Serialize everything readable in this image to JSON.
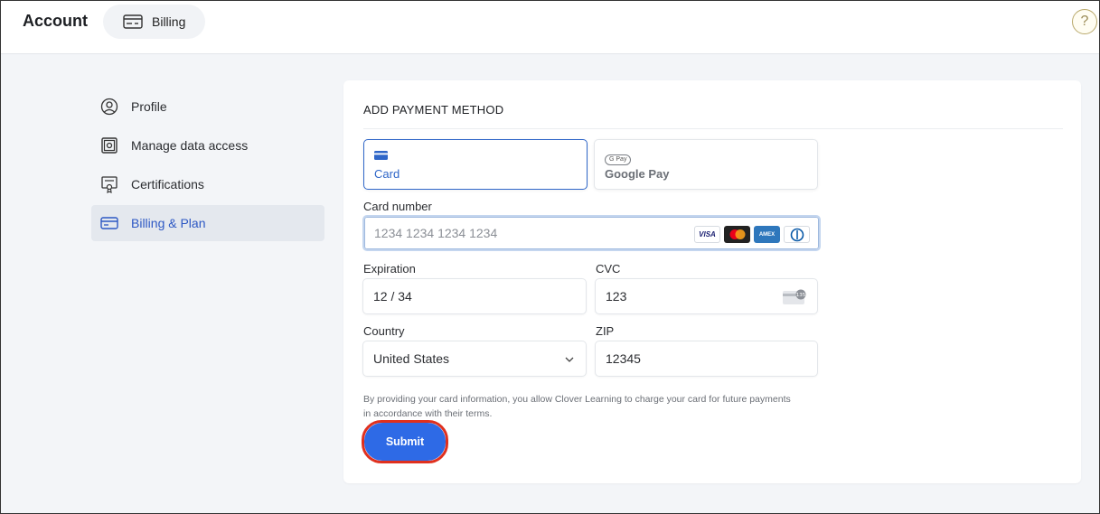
{
  "header": {
    "title": "Account",
    "tab": {
      "label": "Billing",
      "icon": "credit-card-icon"
    },
    "help_icon": "question-icon"
  },
  "sidebar": {
    "items": [
      {
        "label": "Profile",
        "icon": "user-circle-icon",
        "active": false
      },
      {
        "label": "Manage data access",
        "icon": "safe-icon",
        "active": false
      },
      {
        "label": "Certifications",
        "icon": "certificate-icon",
        "active": false
      },
      {
        "label": "Billing & Plan",
        "icon": "credit-card-icon",
        "active": true
      }
    ]
  },
  "payment": {
    "title": "ADD PAYMENT METHOD",
    "methods": [
      {
        "label": "Card",
        "icon": "card-icon",
        "selected": true
      },
      {
        "label": "Google Pay",
        "badge": "G Pay",
        "icon": "google-pay-icon",
        "selected": false
      }
    ],
    "card_number": {
      "label": "Card number",
      "placeholder": "1234 1234 1234 1234",
      "brands": [
        "VISA",
        "Mastercard",
        "AMEX",
        "Diners"
      ]
    },
    "expiration": {
      "label": "Expiration",
      "value": "12 / 34"
    },
    "cvc": {
      "label": "CVC",
      "value": "123",
      "icon_text": "135"
    },
    "country": {
      "label": "Country",
      "value": "United States"
    },
    "zip": {
      "label": "ZIP",
      "value": "12345"
    },
    "disclaimer": "By providing your card information, you allow Clover Learning to charge your card for future payments in accordance with their terms.",
    "submit_label": "Submit"
  },
  "colors": {
    "accent": "#2e6ae6",
    "active_text": "#2d58c4",
    "highlight_ring": "#e0301e"
  }
}
